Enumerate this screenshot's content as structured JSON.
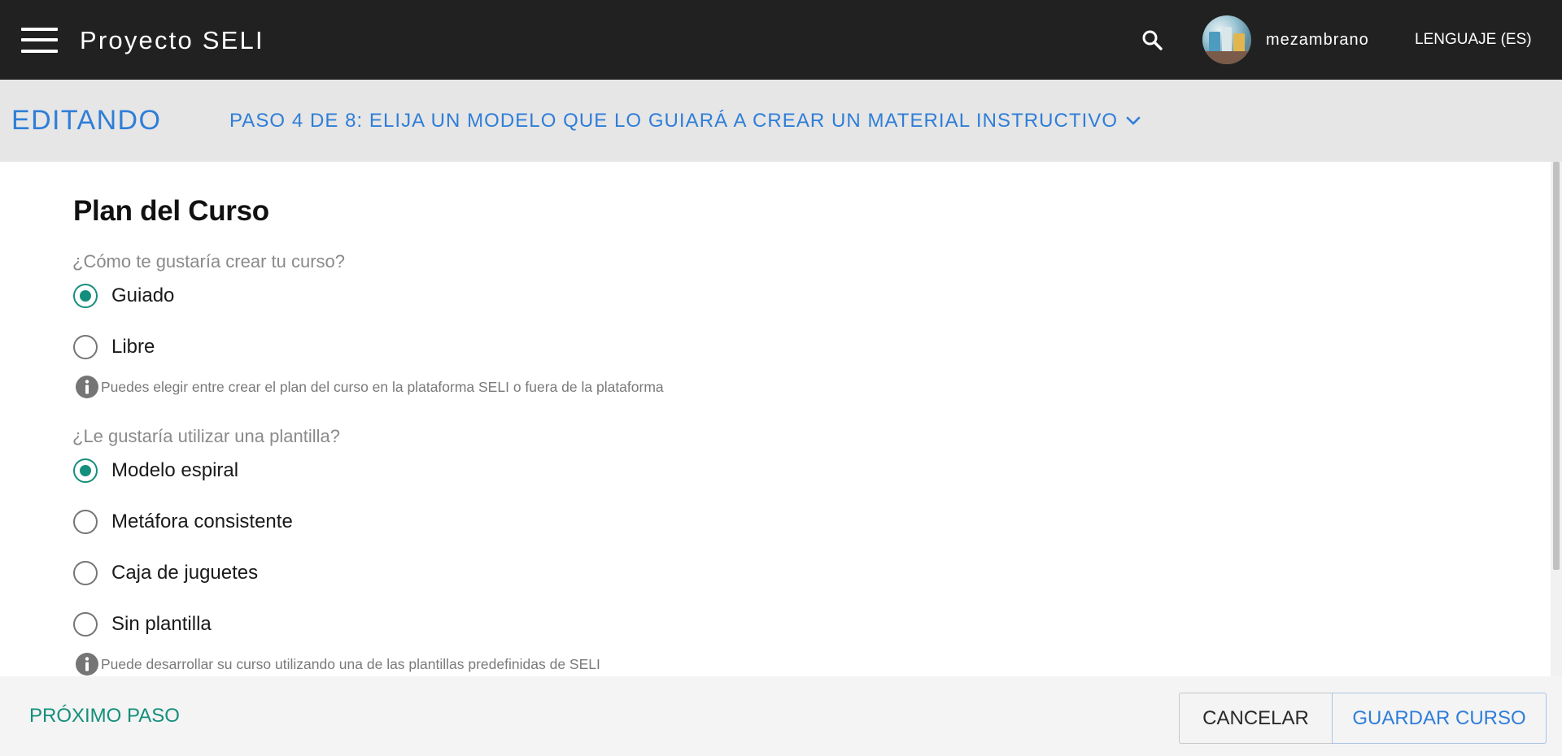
{
  "header": {
    "menu_icon": "hamburger-menu-icon",
    "title": "Proyecto SELI",
    "search_icon": "search-icon",
    "username": "mezambrano",
    "language_label": "LENGUAJE (ES)"
  },
  "stepbar": {
    "mode_label": "EDITANDO",
    "step_label": "PASO 4 DE 8: ELIJA UN MODELO QUE LO GUIARÁ A CREAR UN MATERIAL INSTRUCTIVO",
    "dropdown_icon": "chevron-down-icon"
  },
  "content": {
    "section_title": "Plan del Curso",
    "creation_question": "¿Cómo te gustaría crear tu curso?",
    "creation_options": [
      {
        "label": "Guiado",
        "checked": true
      },
      {
        "label": "Libre",
        "checked": false
      }
    ],
    "creation_help": "Puedes elegir entre crear el plan del curso en la plataforma SELI o fuera de la plataforma",
    "template_question": "¿Le gustaría utilizar una plantilla?",
    "template_options": [
      {
        "label": "Modelo espiral",
        "checked": true
      },
      {
        "label": "Metáfora consistente",
        "checked": false
      },
      {
        "label": "Caja de juguetes",
        "checked": false
      },
      {
        "label": "Sin plantilla",
        "checked": false
      }
    ],
    "template_help": "Puede desarrollar su curso utilizando una de las plantillas predefinidas de SELI"
  },
  "footer": {
    "next_step_label": "PRÓXIMO PASO",
    "cancel_label": "CANCELAR",
    "save_label": "GUARDAR CURSO"
  },
  "colors": {
    "appbar": "#212121",
    "accent_blue": "#2f7ed8",
    "accent_teal": "#148f7c",
    "stepbar_bg": "#e6e6e6",
    "footer_bg": "#f4f4f4"
  }
}
